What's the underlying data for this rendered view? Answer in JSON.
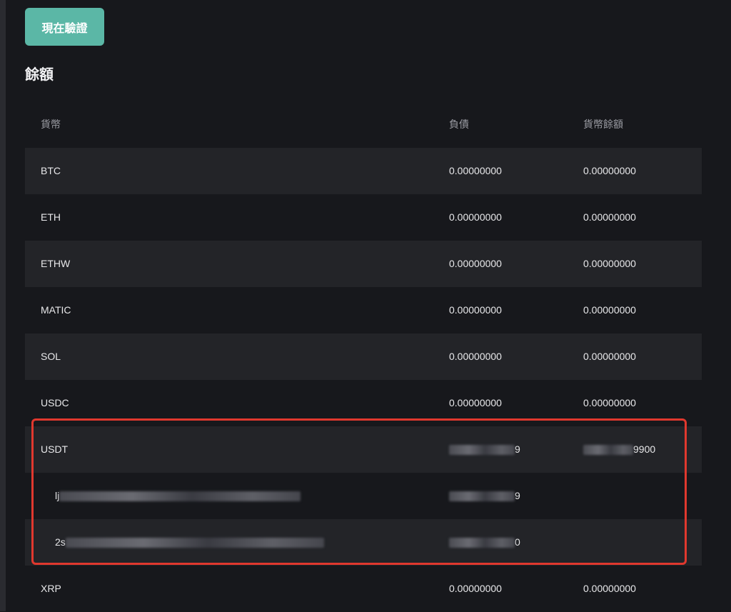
{
  "verify_button": "現在驗證",
  "section_title": "餘額",
  "columns": [
    "貨幣",
    "負債",
    "貨幣餘額"
  ],
  "rows": [
    {
      "currency": "BTC",
      "liability": "0.00000000",
      "balance": "0.00000000"
    },
    {
      "currency": "ETH",
      "liability": "0.00000000",
      "balance": "0.00000000"
    },
    {
      "currency": "ETHW",
      "liability": "0.00000000",
      "balance": "0.00000000"
    },
    {
      "currency": "MATIC",
      "liability": "0.00000000",
      "balance": "0.00000000"
    },
    {
      "currency": "SOL",
      "liability": "0.00000000",
      "balance": "0.00000000"
    },
    {
      "currency": "USDC",
      "liability": "0.00000000",
      "balance": "0.00000000"
    },
    {
      "currency": "USDT",
      "liability_suffix": "9",
      "balance_suffix": "9900"
    },
    {
      "address_prefix": "lj",
      "liability_suffix": "9"
    },
    {
      "address_prefix": "2s",
      "liability_suffix": "0"
    },
    {
      "currency": "XRP",
      "liability": "0.00000000",
      "balance": "0.00000000"
    }
  ],
  "colors": {
    "accent": "#5bb7a6",
    "highlight": "#e0382e"
  }
}
